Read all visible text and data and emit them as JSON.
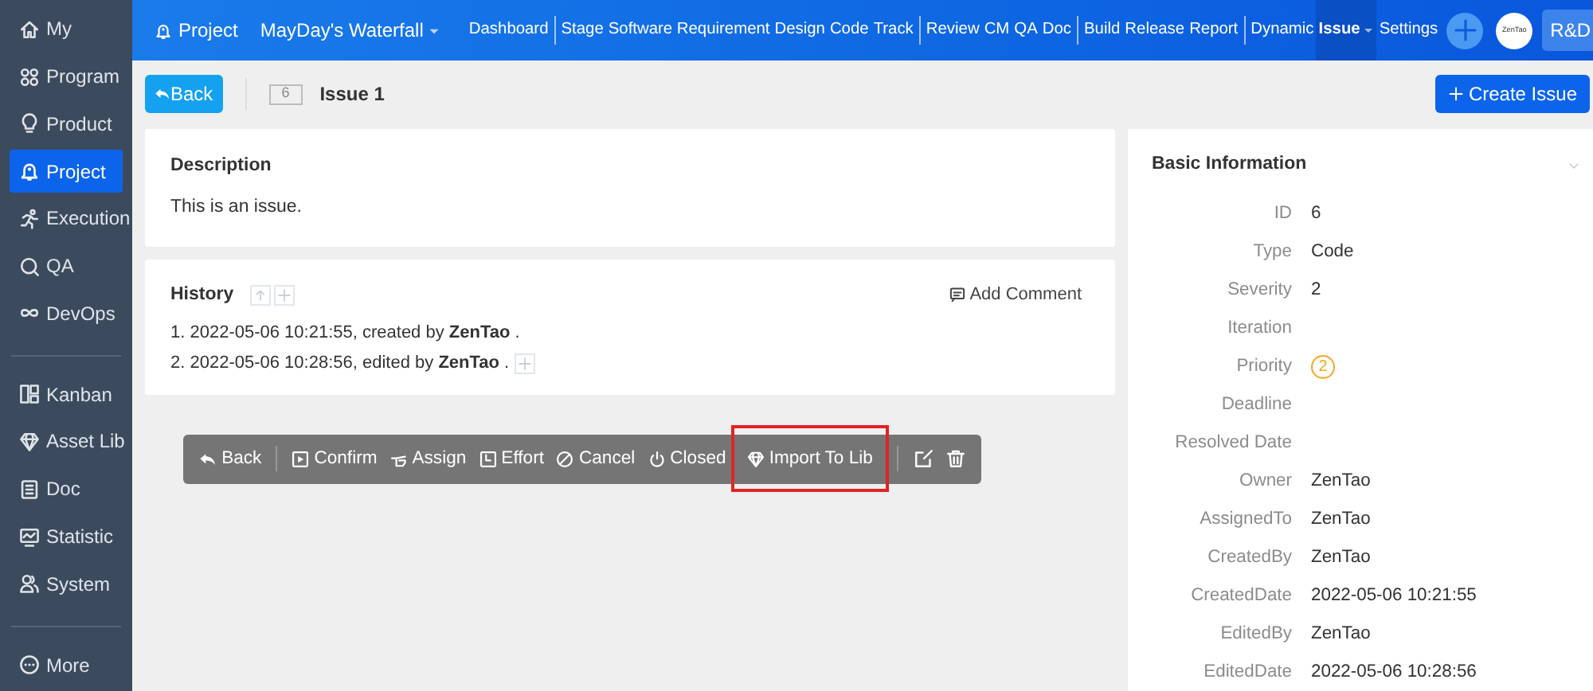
{
  "sidebar": {
    "groups": [
      [
        {
          "label": "My",
          "selected": false
        },
        {
          "label": "Program",
          "selected": false
        },
        {
          "label": "Product",
          "selected": false
        },
        {
          "label": "Project",
          "selected": true
        },
        {
          "label": "Execution",
          "selected": false
        },
        {
          "label": "QA",
          "selected": false
        },
        {
          "label": "DevOps",
          "selected": false
        }
      ],
      [
        {
          "label": "Kanban",
          "selected": false
        },
        {
          "label": "Asset Lib",
          "selected": false
        },
        {
          "label": "Doc",
          "selected": false
        },
        {
          "label": "Statistic",
          "selected": false
        },
        {
          "label": "System",
          "selected": false
        }
      ],
      [
        {
          "label": "More",
          "selected": false
        }
      ]
    ]
  },
  "topbar": {
    "section": "Project",
    "project": "MayDay's Waterfall",
    "nav": [
      [
        {
          "label": "Dashboard",
          "selected": false
        }
      ],
      [
        {
          "label": "Stage",
          "selected": false
        },
        {
          "label": "Software Requirement",
          "selected": false
        },
        {
          "label": "Design",
          "selected": false
        },
        {
          "label": "Code",
          "selected": false
        },
        {
          "label": "Track",
          "selected": false
        }
      ],
      [
        {
          "label": "Review",
          "selected": false
        },
        {
          "label": "CM",
          "selected": false
        },
        {
          "label": "QA",
          "selected": false
        },
        {
          "label": "Doc",
          "selected": false
        }
      ],
      [
        {
          "label": "Build",
          "selected": false
        },
        {
          "label": "Release",
          "selected": false
        },
        {
          "label": "Report",
          "selected": false
        }
      ],
      [
        {
          "label": "Dynamic",
          "selected": false
        },
        {
          "label": "Issue",
          "selected": true
        },
        {
          "label": "Settings",
          "selected": false
        }
      ]
    ],
    "avatar": "ZenTao",
    "mode": "R&D"
  },
  "header": {
    "back": "Back",
    "id": "6",
    "title": "Issue 1",
    "create": "Create Issue"
  },
  "description": {
    "title": "Description",
    "text": "This is an issue."
  },
  "history": {
    "title": "History",
    "add_comment": "Add Comment",
    "entries": [
      "1. 2022-05-06 10:21:55, created by **ZenTao** .",
      "2. 2022-05-06 10:28:56, edited by **ZenTao** ."
    ]
  },
  "actions": [
    {
      "label": "Back",
      "highlighted": false
    },
    {
      "label": "Confirm",
      "highlighted": false
    },
    {
      "label": "Assign",
      "highlighted": false
    },
    {
      "label": "Effort",
      "highlighted": false
    },
    {
      "label": "Cancel",
      "highlighted": false
    },
    {
      "label": "Closed",
      "highlighted": false
    },
    {
      "label": "Import To Lib",
      "highlighted": true
    }
  ],
  "basic_info": {
    "title": "Basic Information",
    "fields": [
      {
        "label": "ID",
        "value": "6"
      },
      {
        "label": "Type",
        "value": "Code"
      },
      {
        "label": "Severity",
        "value": "2"
      },
      {
        "label": "Iteration"
      },
      {
        "label": "Priority",
        "value": "2",
        "kind": "badge"
      },
      {
        "label": "Deadline"
      },
      {
        "label": "Resolved Date"
      },
      {
        "label": "Owner",
        "value": "ZenTao"
      },
      {
        "label": "AssignedTo",
        "value": "ZenTao"
      },
      {
        "label": "CreatedBy",
        "value": "ZenTao"
      },
      {
        "label": "CreatedDate",
        "value": "2022-05-06 10:21:55"
      },
      {
        "label": "EditedBy",
        "value": "ZenTao"
      },
      {
        "label": "EditedDate",
        "value": "2022-05-06 10:28:56"
      }
    ]
  }
}
